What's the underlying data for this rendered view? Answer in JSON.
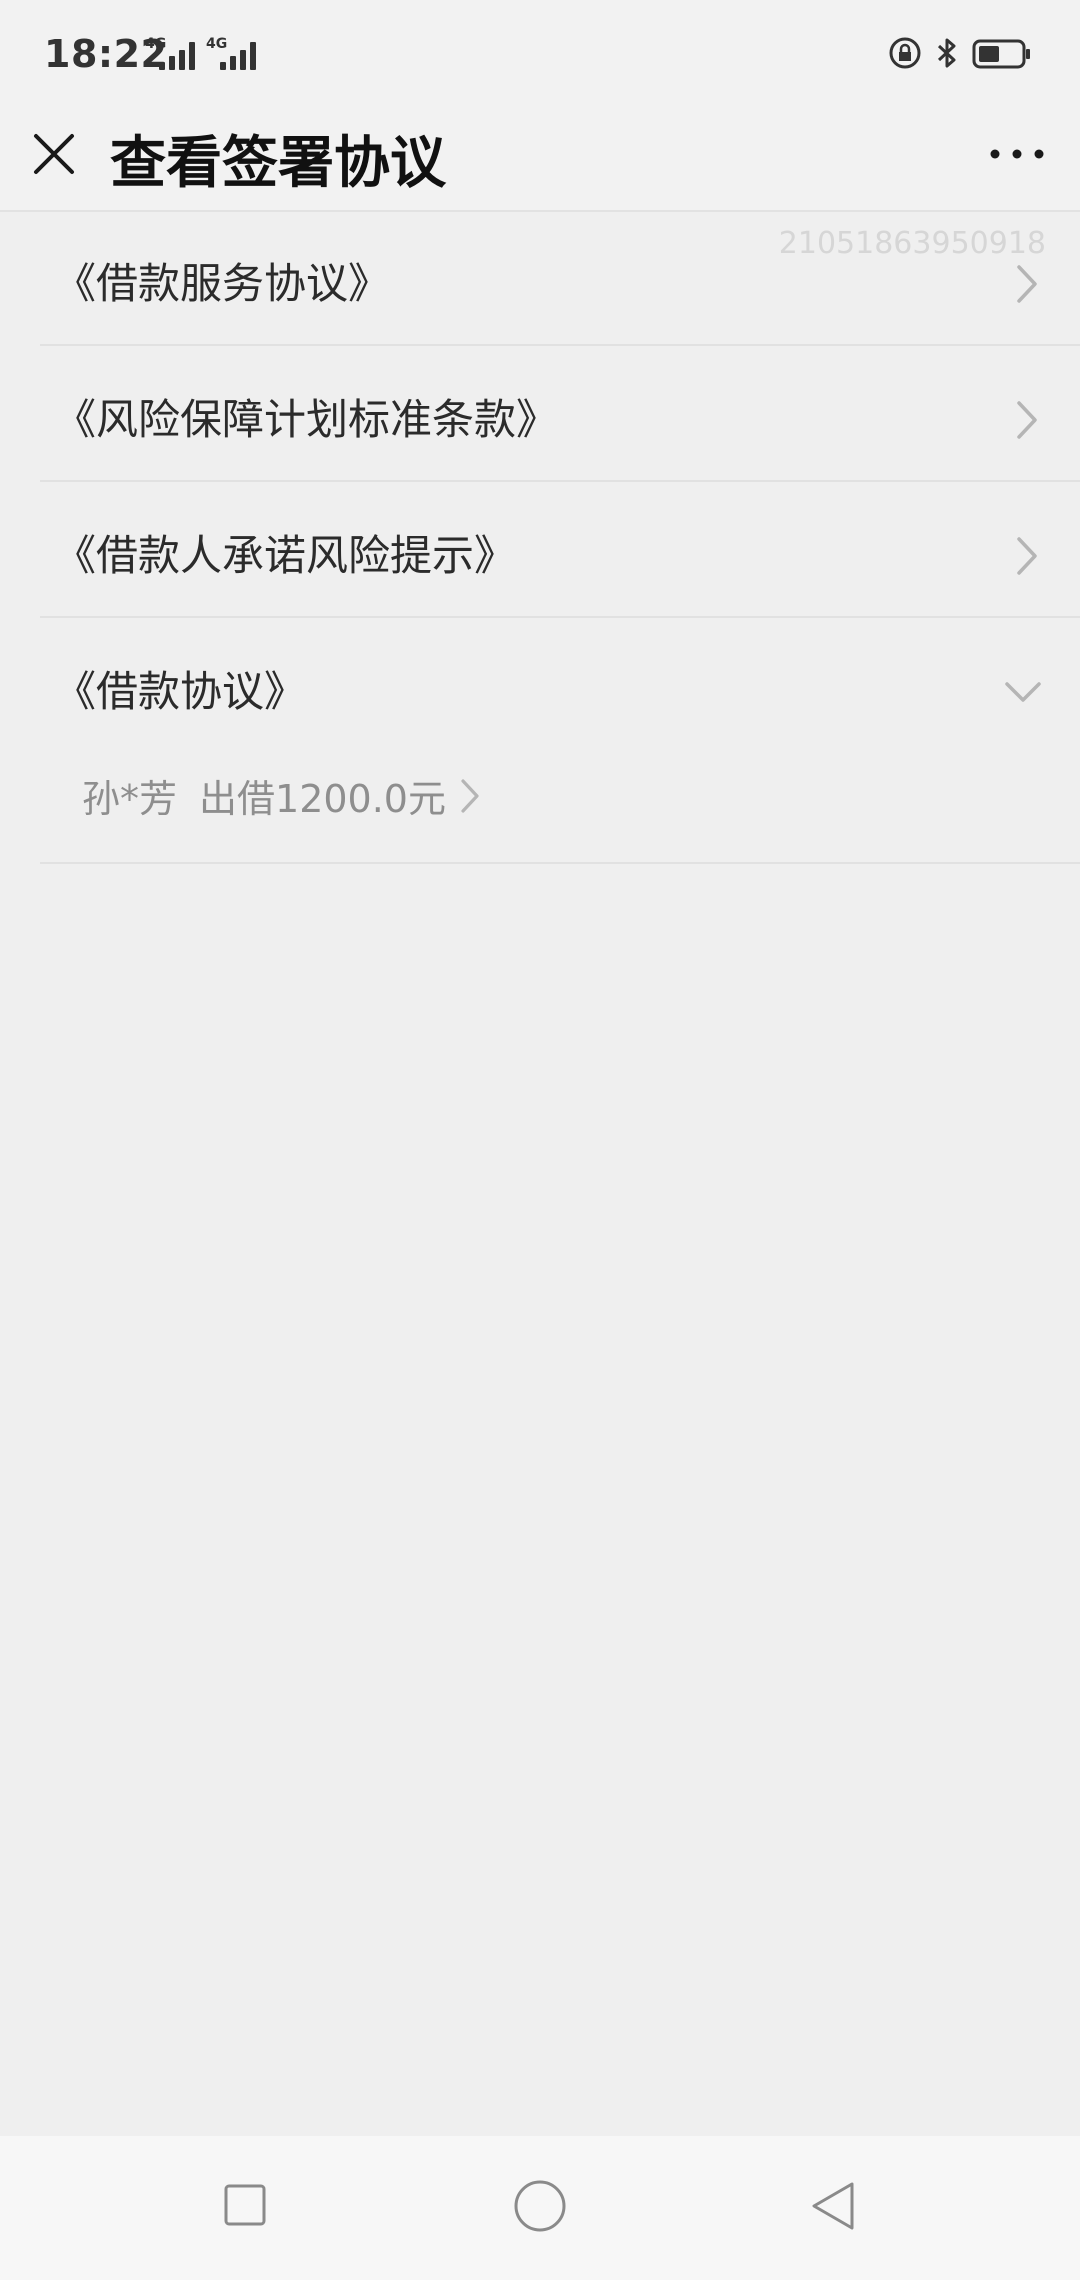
{
  "status_bar": {
    "time": "18:22",
    "network_1": "4G",
    "network_2": "4G"
  },
  "header": {
    "title": "查看签署协议"
  },
  "list": {
    "watermark": "21051863950918",
    "items": [
      {
        "label": "《借款服务协议》"
      },
      {
        "label": "《风险保障计划标准条款》"
      },
      {
        "label": "《借款人承诺风险提示》"
      }
    ],
    "expanded": {
      "label": "《借款协议》",
      "sub_name": "孙*芳",
      "sub_amount": "出借1200.0元"
    }
  },
  "icons": {
    "close": "close-icon",
    "more": "more-icon",
    "chevron_right": "chevron-right-icon",
    "chevron_down": "chevron-down-icon"
  }
}
